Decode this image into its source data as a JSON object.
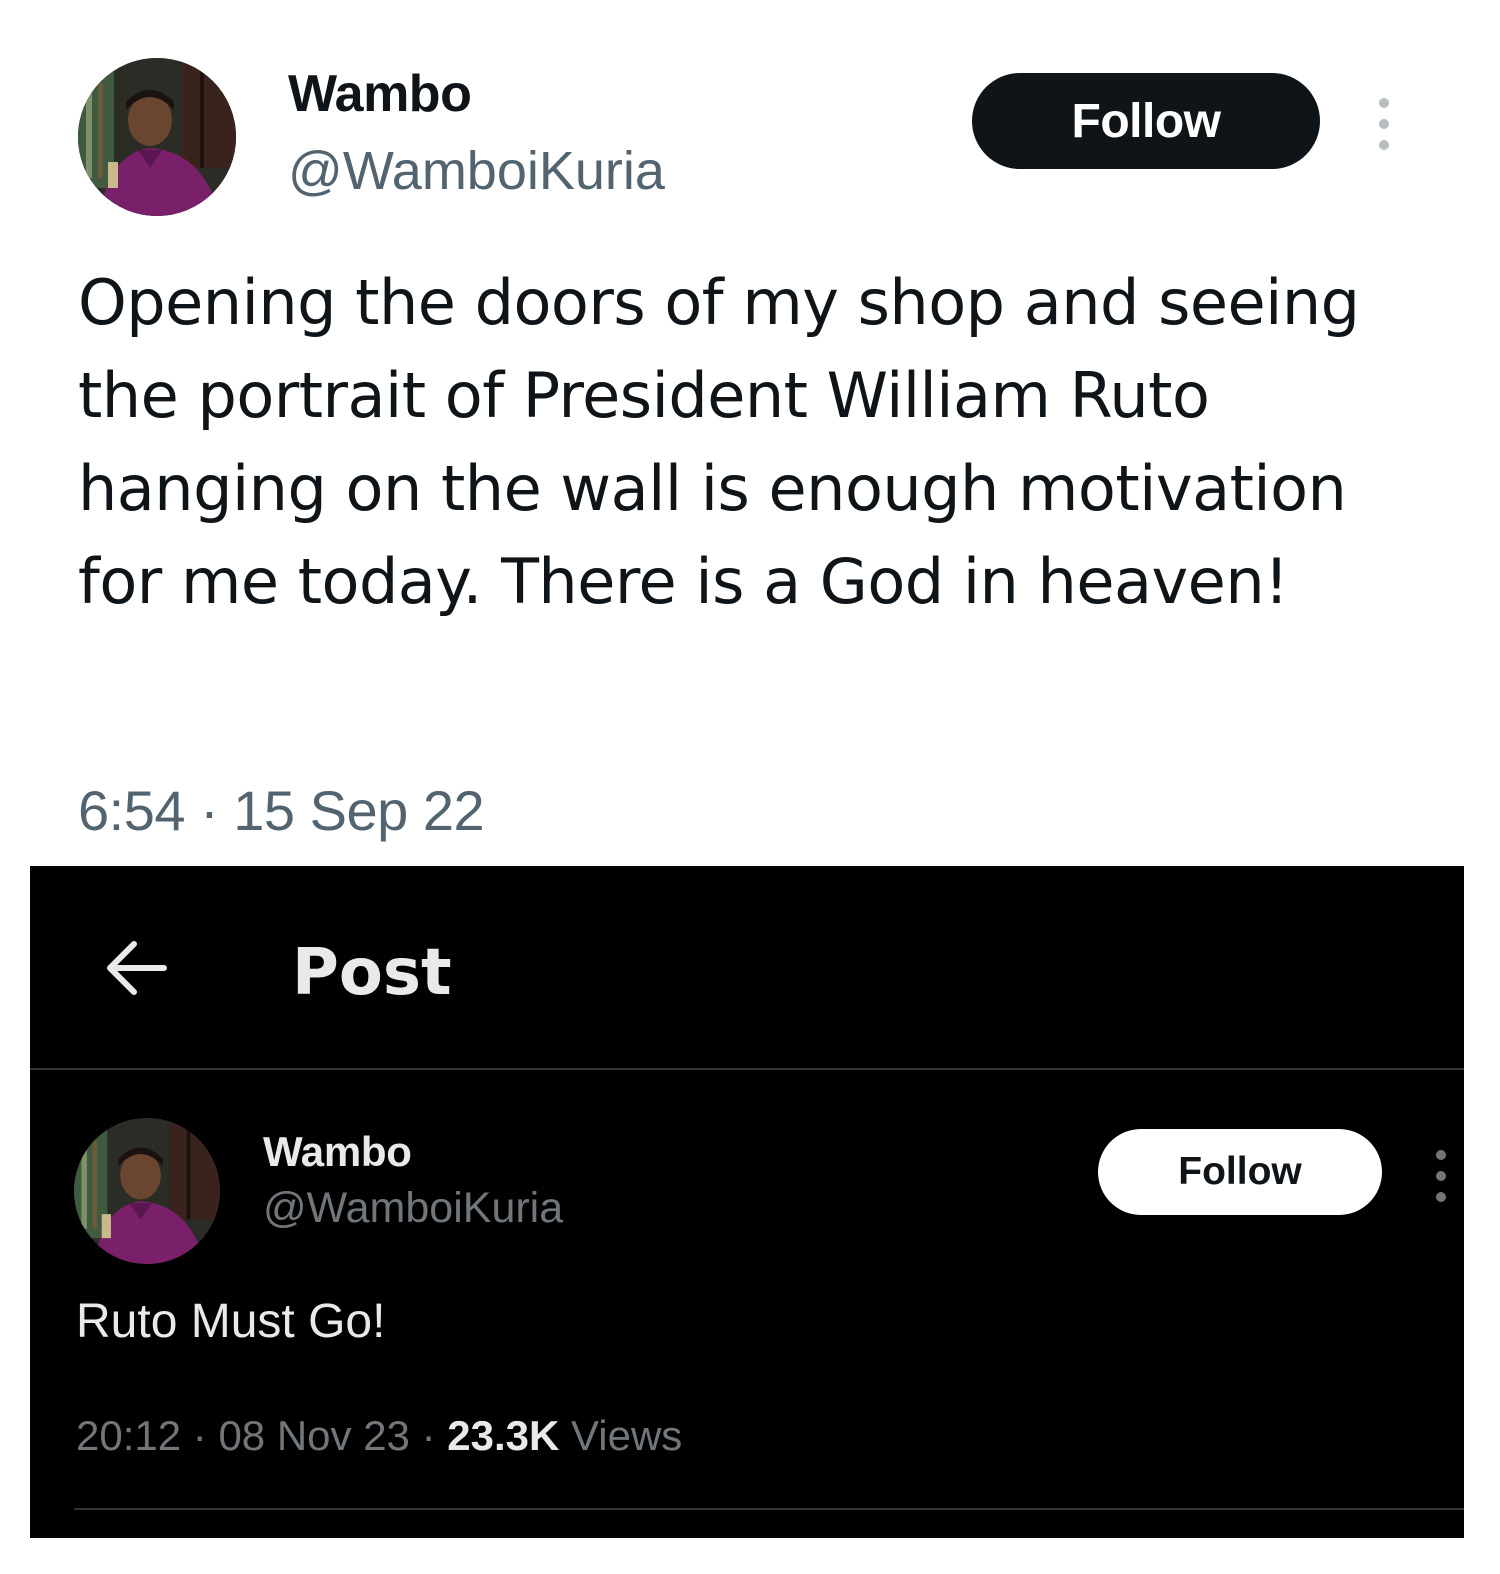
{
  "light_tweet": {
    "display_name": "Wambo",
    "handle": "@WamboiKuria",
    "follow_label": "Follow",
    "more_icon": "more-vertical-icon",
    "text": "Opening the doors of my shop and seeing the portrait of President William Ruto hanging on the wall is enough motivation for me today. There is a God in heaven!",
    "time": "6:54",
    "separator": "·",
    "date": "15 Sep 22",
    "colors": {
      "background": "#ffffff",
      "text": "#0f1419",
      "secondary": "#536471",
      "button": "#0f1419"
    }
  },
  "dark_post": {
    "back_icon": "arrow-left-icon",
    "title": "Post",
    "display_name": "Wambo",
    "handle": "@WamboiKuria",
    "follow_label": "Follow",
    "more_icon": "more-vertical-icon",
    "text": "Ruto Must Go!",
    "time": "20:12",
    "separator": "·",
    "date": "08 Nov 23",
    "views_count": "23.3K",
    "views_label": "Views",
    "colors": {
      "background": "#000000",
      "text": "#e7e9ea",
      "secondary": "#71767b",
      "button": "#ffffff"
    }
  }
}
